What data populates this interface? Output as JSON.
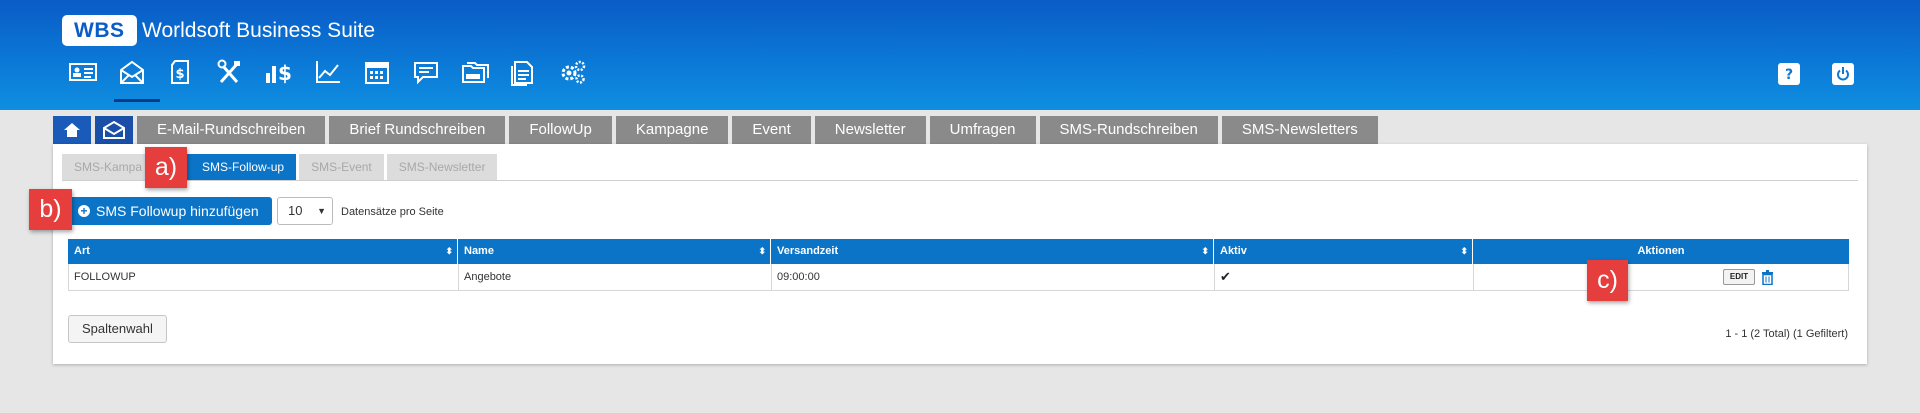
{
  "header": {
    "logo": "WBS",
    "title": "Worldsoft Business Suite",
    "nav_icons": [
      "contacts-card-icon",
      "newsletter-mail-icon",
      "finance-document-icon",
      "tools-icon",
      "sales-chart-dollar-icon",
      "statistics-line-icon",
      "calendar-icon",
      "message-icon",
      "folders-icon",
      "documents-icon",
      "settings-gears-icon"
    ],
    "utility_icons": [
      "help-icon",
      "power-icon"
    ]
  },
  "main_tabs": [
    "E-Mail-Rundschreiben",
    "Brief Rundschreiben",
    "FollowUp",
    "Kampagne",
    "Event",
    "Newsletter",
    "Umfragen",
    "SMS-Rundschreiben",
    "SMS-Newsletters"
  ],
  "sub_tabs": {
    "items": [
      "SMS-Kampa",
      "SMS-Follow-up",
      "SMS-Event",
      "SMS-Newsletter"
    ],
    "active": "SMS-Follow-up"
  },
  "toolbar": {
    "add_button": "SMS Followup hinzufügen",
    "page_size": "10",
    "per_page_label": "Datensätze pro Seite"
  },
  "table": {
    "headers": [
      "Art",
      "Name",
      "Versandzeit",
      "Aktiv",
      "Aktionen"
    ],
    "rows": [
      {
        "art": "FOLLOWUP",
        "name": "Angebote",
        "versandzeit": "09:00:00",
        "aktiv": "✔",
        "edit": "EDIT"
      }
    ]
  },
  "footer": {
    "column_button": "Spaltenwahl",
    "pager_info": "1 - 1 (2 Total) (1 Gefiltert)"
  },
  "callouts": {
    "a": "a)",
    "b": "b)",
    "c": "c)"
  },
  "colors": {
    "header_blue": "#0b78d6",
    "accent_blue": "#0b74c7",
    "tab_gray": "#8a8a8a",
    "callout_red": "#e63d3d"
  }
}
